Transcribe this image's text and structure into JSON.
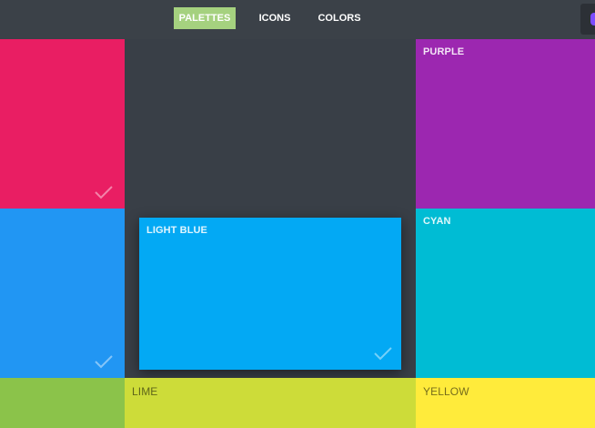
{
  "nav": {
    "items": [
      {
        "label": "PALETTES",
        "active": true
      },
      {
        "label": "ICONS",
        "active": false
      },
      {
        "label": "COLORS",
        "active": false
      }
    ]
  },
  "tiles": {
    "pink": {
      "label": "",
      "color": "#e91e63",
      "selected": true
    },
    "purple": {
      "label": "PURPLE",
      "color": "#9c27b0",
      "selected": false
    },
    "blue": {
      "label": "",
      "color": "#2196f3",
      "selected": true
    },
    "light_blue": {
      "label": "LIGHT BLUE",
      "color": "#03a9f4",
      "selected": true
    },
    "cyan": {
      "label": "CYAN",
      "color": "#00bcd4",
      "selected": false
    },
    "light_green": {
      "label": "",
      "color": "#8bc34a",
      "selected": false
    },
    "lime": {
      "label": "LIME",
      "color": "#cddc39",
      "selected": false
    },
    "yellow": {
      "label": "YELLOW",
      "color": "#ffeb3b",
      "selected": false
    }
  },
  "colors": {
    "topbar": "#3b4148",
    "background": "#393f47",
    "accent": "#a5d17f"
  }
}
